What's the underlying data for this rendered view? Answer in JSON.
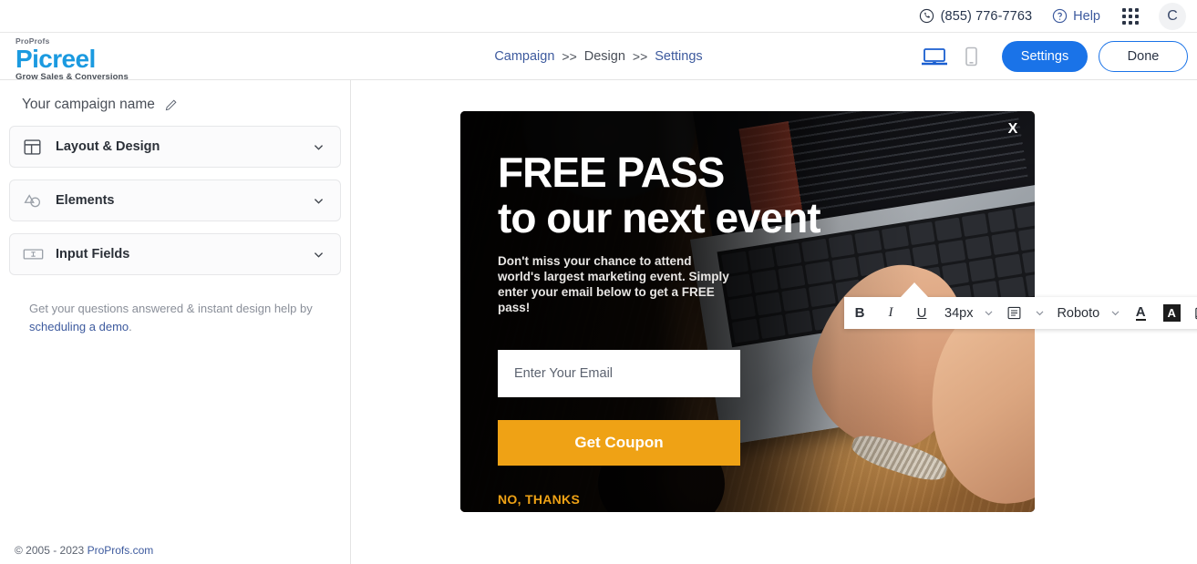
{
  "utility_bar": {
    "phone": "(855) 776-7763",
    "phone_icon": "phone-circle-icon",
    "help_label": "Help",
    "help_icon": "question-circle-icon",
    "apps_icon": "apps-grid-icon",
    "avatar_initial": "C"
  },
  "header": {
    "logo": {
      "top": "ProProfs",
      "main": "Picreel",
      "sub": "Grow Sales & Conversions",
      "color": "#1b9ae0"
    },
    "breadcrumb": {
      "items": [
        {
          "label": "Campaign",
          "active": false
        },
        {
          "label": "Design",
          "active": true
        },
        {
          "label": "Settings",
          "active": false
        }
      ],
      "separator": ">>"
    },
    "devices": [
      {
        "name": "desktop",
        "icon": "laptop-icon",
        "active": true
      },
      {
        "name": "mobile",
        "icon": "mobile-icon",
        "active": false
      }
    ],
    "settings_button": "Settings",
    "done_button": "Done",
    "accent_color": "#1a73e8"
  },
  "sidebar": {
    "campaign_name": "Your campaign name",
    "edit_icon": "pencil-icon",
    "panels": [
      {
        "label": "Layout & Design",
        "icon": "layout-grid-icon",
        "chevron": "chevron-down-icon"
      },
      {
        "label": "Elements",
        "icon": "shapes-icon",
        "chevron": "chevron-down-icon"
      },
      {
        "label": "Input Fields",
        "icon": "input-field-icon",
        "chevron": "chevron-down-icon"
      }
    ],
    "help_text": "Get your questions answered & instant design help by ",
    "help_link": "scheduling a demo",
    "help_period": "."
  },
  "footer": {
    "copyright": "© 2005 - 2023 ",
    "link": "ProProfs.com"
  },
  "text_toolbar": {
    "bold": "B",
    "italic": "I",
    "underline": "U",
    "font_size": "34px",
    "align_icon": "text-align-icon",
    "font_family": "Roboto",
    "text_color_icon": "text-color-icon",
    "highlight_icon": "highlight-color-icon",
    "image_icon": "insert-image-icon",
    "resize_icon": "resize-icon",
    "undo_icon": "undo-icon",
    "delete_icon": "trash-icon",
    "chevron_icon": "chevron-down-icon"
  },
  "popup": {
    "close_label": "X",
    "headline_line1": "FREE PASS",
    "headline_line2": "to our next event",
    "body": "Don't miss your chance to attend world's largest marketing event. Simply enter your email below to get a FREE pass!",
    "email_placeholder": "Enter Your Email",
    "cta_label": "Get Coupon",
    "decline_label": "NO, THANKS",
    "cta_color": "#efa215",
    "decline_color": "#efa215"
  }
}
